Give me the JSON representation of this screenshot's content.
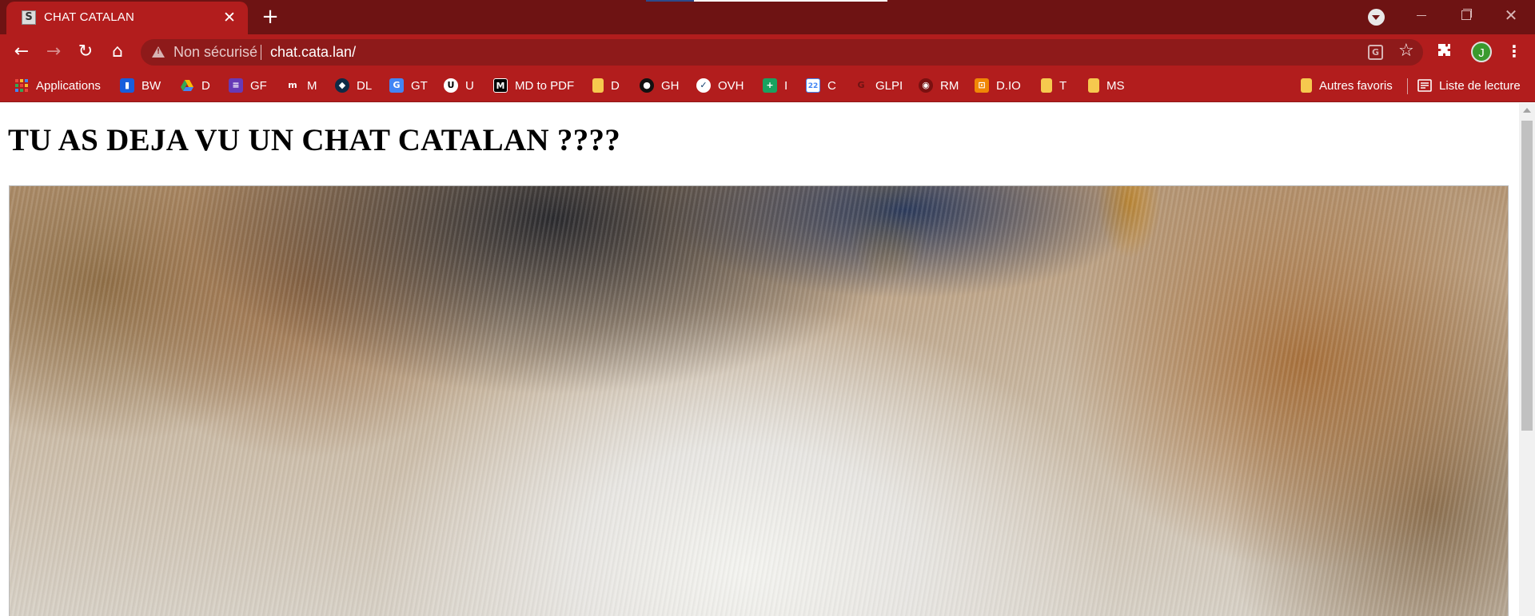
{
  "tab": {
    "title": "CHAT CATALAN",
    "favicon": "S",
    "close": "✕"
  },
  "tabstrip": {
    "new_tab": "+"
  },
  "toolbar": {
    "back": "←",
    "forward": "→",
    "reload": "↻",
    "home": "⌂",
    "security_label": "Non sécurisé",
    "url": "chat.cata.lan/",
    "avatar_letter": "J",
    "menu": "⋮",
    "star": "☆",
    "translate": "G"
  },
  "bookmarks": {
    "items": [
      {
        "label": "Applications",
        "icon": "apps-grid-icon",
        "color": "#e8453c"
      },
      {
        "label": "BW",
        "icon": "bitwarden-icon",
        "color": "#175ddc",
        "glyph": "▮"
      },
      {
        "label": "D",
        "icon": "google-drive-icon",
        "color": "#34a853",
        "glyph": "▲"
      },
      {
        "label": "GF",
        "icon": "google-forms-icon",
        "color": "#673ab7",
        "glyph": "≡"
      },
      {
        "label": "M",
        "icon": "m-logo-icon",
        "color": "#222222",
        "glyph": "m"
      },
      {
        "label": "DL",
        "icon": "deepl-icon",
        "color": "#0f2b46",
        "glyph": "◆"
      },
      {
        "label": "GT",
        "icon": "google-translate-icon",
        "color": "#4285f4",
        "glyph": "G"
      },
      {
        "label": "U",
        "icon": "u-logo-icon",
        "color": "#ffffff",
        "glyph": "U"
      },
      {
        "label": "MD to PDF",
        "icon": "md-logo-icon",
        "color": "#000000",
        "glyph": "M"
      },
      {
        "label": "D",
        "icon": "folder-icon",
        "color": "#f6c94e"
      },
      {
        "label": "GH",
        "icon": "github-icon",
        "color": "#111111",
        "glyph": "●"
      },
      {
        "label": "OVH",
        "icon": "ovh-icon",
        "color": "#ffffff",
        "glyph": "✓"
      },
      {
        "label": "I",
        "icon": "plus-cross-icon",
        "color": "#1aa260",
        "glyph": "+"
      },
      {
        "label": "C",
        "icon": "google-calendar-icon",
        "color": "#4285f4",
        "glyph": "22"
      },
      {
        "label": "GLPI",
        "icon": "glpi-icon",
        "color": "#b21d1d",
        "glyph": "G"
      },
      {
        "label": "RM",
        "icon": "redmine-icon",
        "color": "#7a1010",
        "glyph": "◉"
      },
      {
        "label": "D.IO",
        "icon": "drawio-icon",
        "color": "#f08705",
        "glyph": "⊡"
      },
      {
        "label": "T",
        "icon": "folder-icon",
        "color": "#f6c94e"
      },
      {
        "label": "MS",
        "icon": "folder-icon",
        "color": "#f6c94e"
      }
    ],
    "other": {
      "label": "Autres favoris",
      "icon": "folder-icon"
    },
    "reading_list": {
      "label": "Liste de lecture",
      "icon": "reading-list-icon"
    }
  },
  "page": {
    "heading": "TU AS DEJA VU UN CHAT CATALAN ????"
  },
  "colors": {
    "tabstrip": "#6e1313",
    "toolbar": "#b21d1d",
    "omnibox": "#8e1a1a"
  }
}
